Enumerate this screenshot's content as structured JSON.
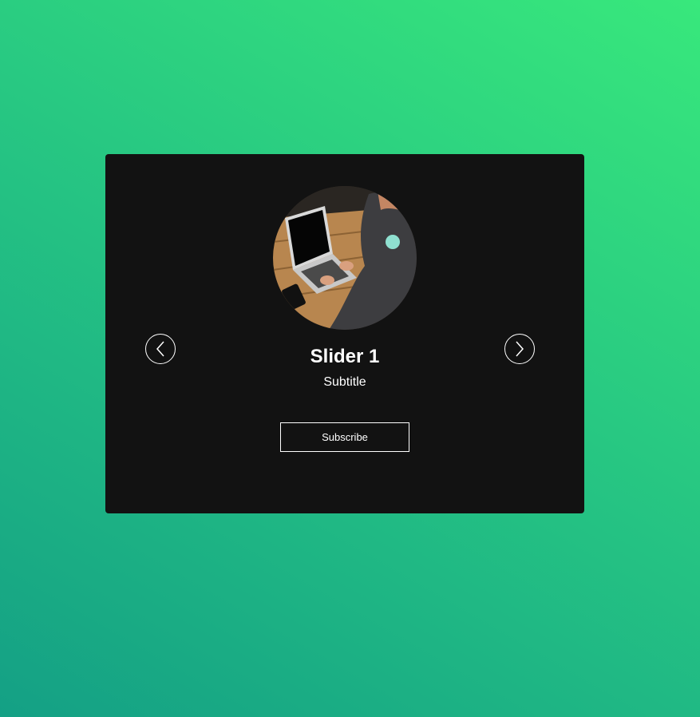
{
  "slider": {
    "title": "Slider 1",
    "subtitle": "Subtitle",
    "button_label": "Subscribe",
    "image_icon": "laptop-photo",
    "prev_icon": "chevron-left-icon",
    "next_icon": "chevron-right-icon"
  },
  "colors": {
    "card_background": "#121212",
    "gradient_start": "#14a085",
    "gradient_end": "#38e87c",
    "text": "#ffffff"
  }
}
